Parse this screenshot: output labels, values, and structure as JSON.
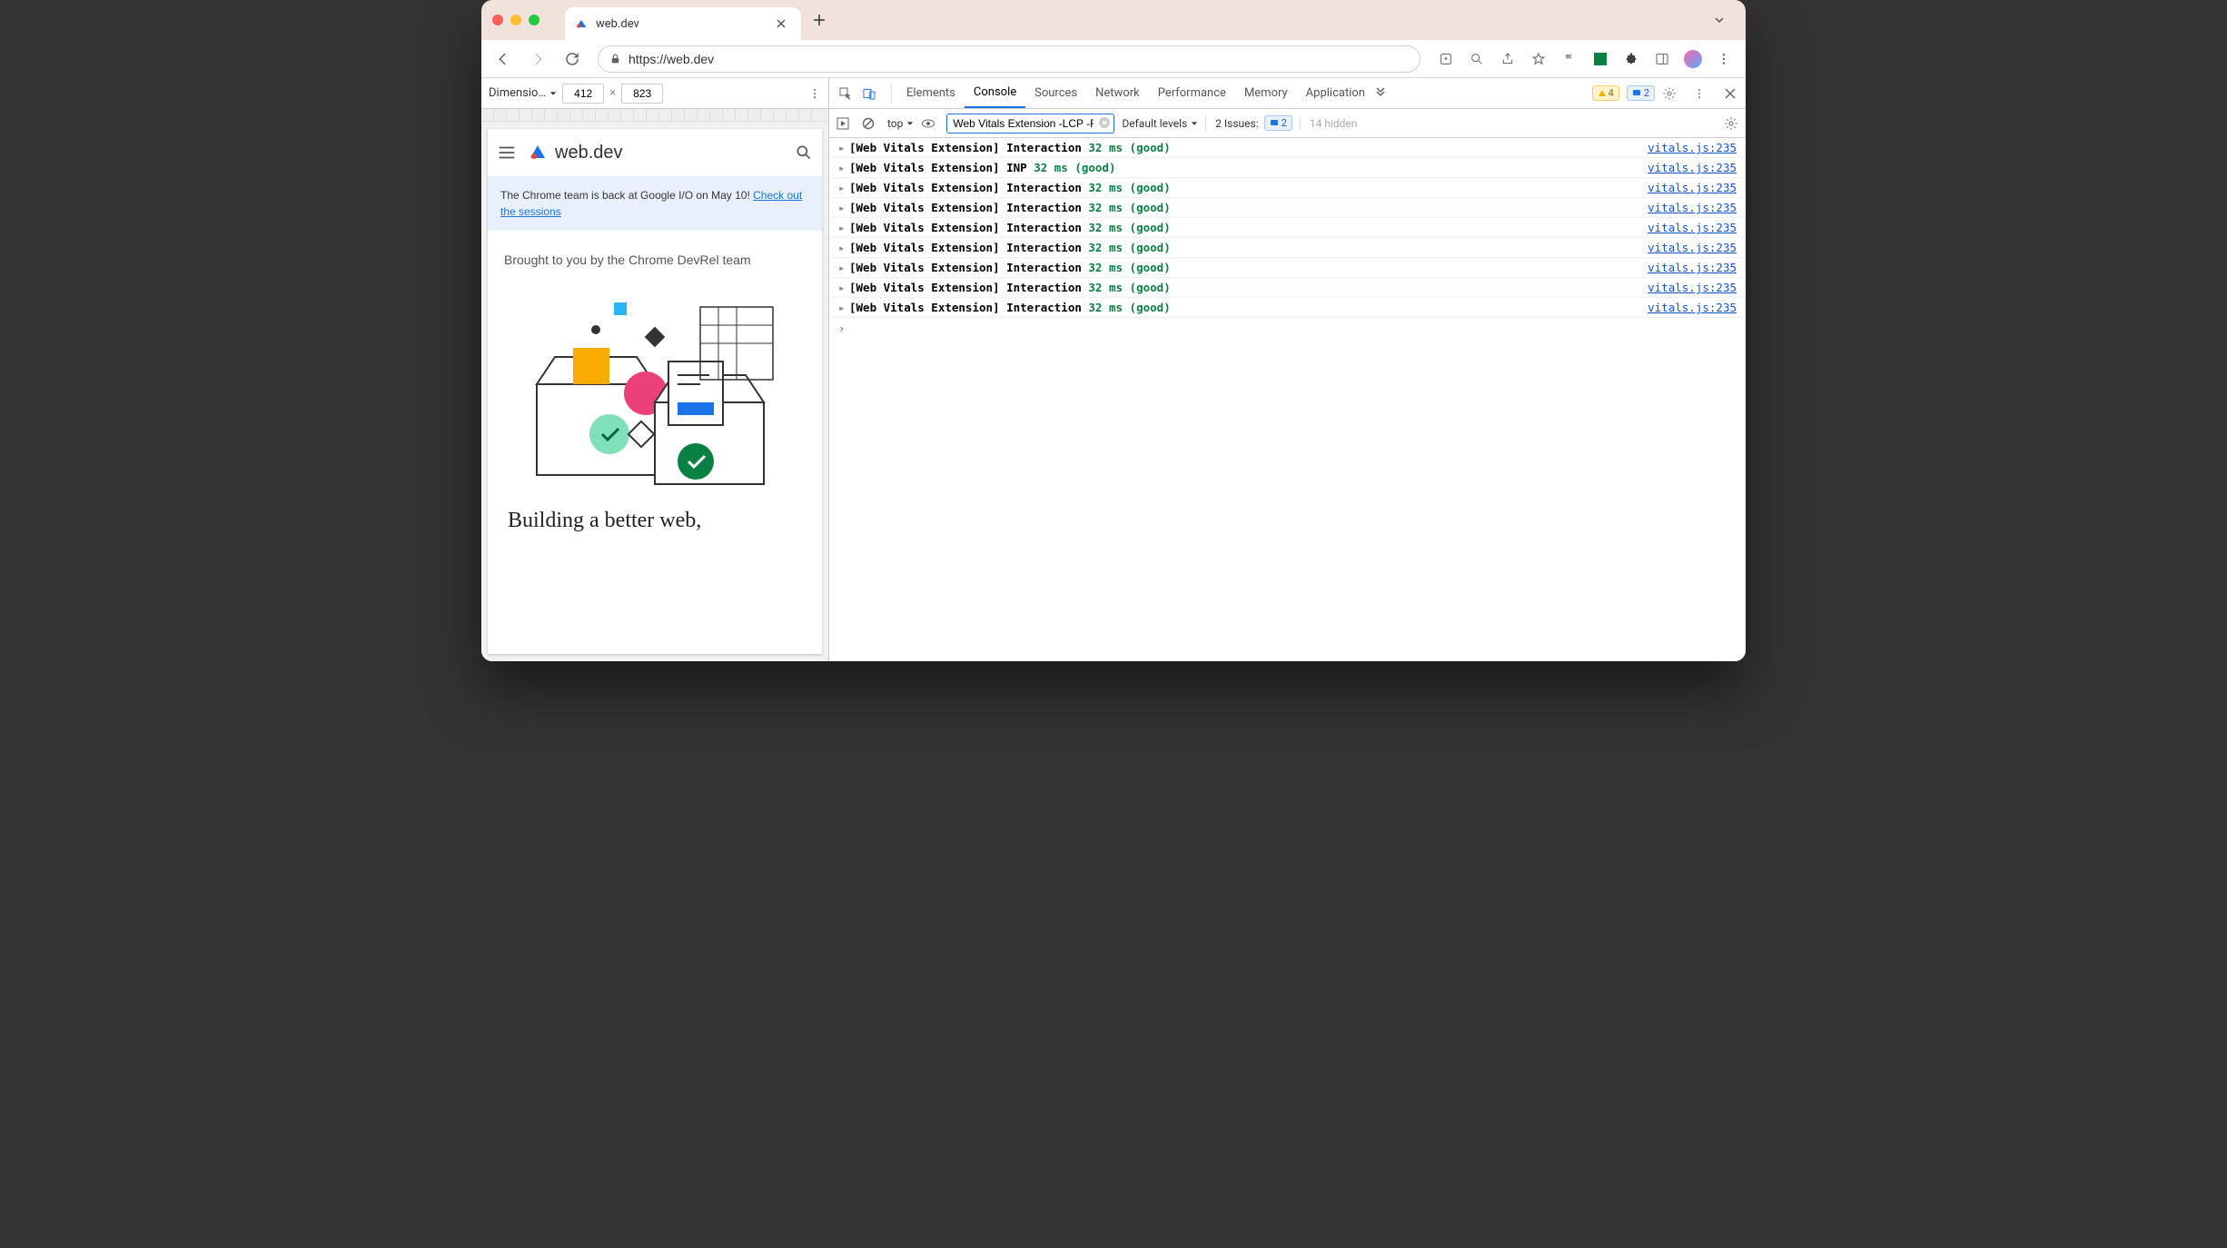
{
  "browser_tab": {
    "title": "web.dev",
    "url": "https://web.dev"
  },
  "device_toolbar": {
    "label": "Dimensio…",
    "width": "412",
    "height": "823"
  },
  "page": {
    "site_name": "web.dev",
    "banner_text": "The Chrome team is back at Google I/O on May 10! ",
    "banner_link": "Check out the sessions",
    "subtitle": "Brought to you by the Chrome DevRel team",
    "headline": "Building a better web,"
  },
  "devtools": {
    "tabs": [
      "Elements",
      "Console",
      "Sources",
      "Network",
      "Performance",
      "Memory",
      "Application"
    ],
    "active_tab": "Console",
    "warn_count": "4",
    "msg_count": "2",
    "context": "top",
    "filter_value": "Web Vitals Extension -LCP -FID -CLS",
    "levels_label": "Default levels",
    "issues_label": "2 Issues:",
    "issues_count": "2",
    "hidden_label": "14 hidden",
    "logs": [
      {
        "prefix": "[Web Vitals Extension]",
        "label": "Interaction",
        "value": "32 ms (good)",
        "source": "vitals.js:235"
      },
      {
        "prefix": "[Web Vitals Extension]",
        "label": "INP",
        "value": "32 ms (good)",
        "source": "vitals.js:235"
      },
      {
        "prefix": "[Web Vitals Extension]",
        "label": "Interaction",
        "value": "32 ms (good)",
        "source": "vitals.js:235"
      },
      {
        "prefix": "[Web Vitals Extension]",
        "label": "Interaction",
        "value": "32 ms (good)",
        "source": "vitals.js:235"
      },
      {
        "prefix": "[Web Vitals Extension]",
        "label": "Interaction",
        "value": "32 ms (good)",
        "source": "vitals.js:235"
      },
      {
        "prefix": "[Web Vitals Extension]",
        "label": "Interaction",
        "value": "32 ms (good)",
        "source": "vitals.js:235"
      },
      {
        "prefix": "[Web Vitals Extension]",
        "label": "Interaction",
        "value": "32 ms (good)",
        "source": "vitals.js:235"
      },
      {
        "prefix": "[Web Vitals Extension]",
        "label": "Interaction",
        "value": "32 ms (good)",
        "source": "vitals.js:235"
      },
      {
        "prefix": "[Web Vitals Extension]",
        "label": "Interaction",
        "value": "32 ms (good)",
        "source": "vitals.js:235"
      }
    ]
  }
}
